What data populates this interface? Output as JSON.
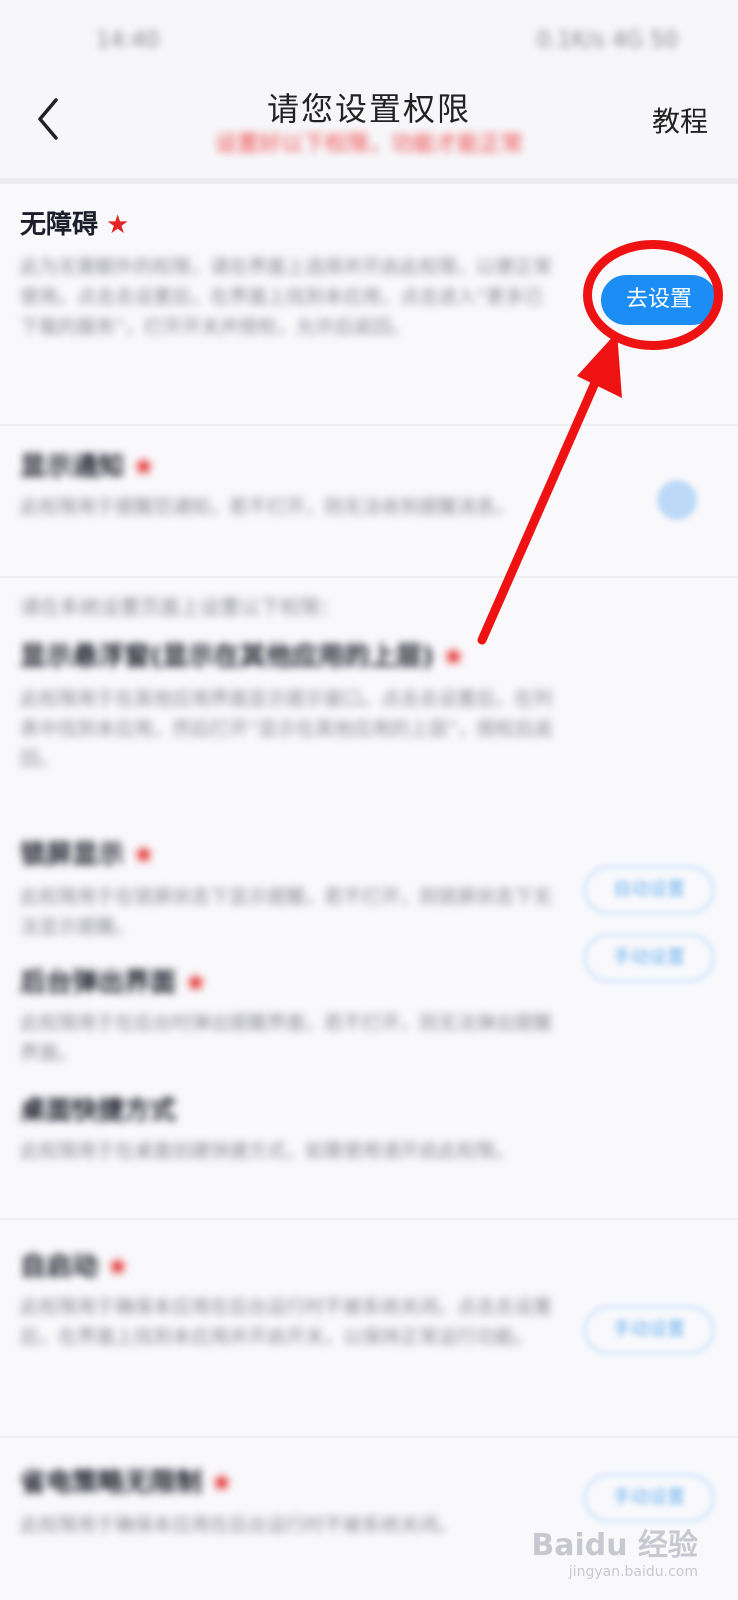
{
  "status_bar": {
    "time": "14:40",
    "icons": "0.1K/s 4G 50"
  },
  "header": {
    "title": "请您设置权限",
    "subtitle": "设置好以下权限，功能才能正常",
    "tutorial_label": "教程"
  },
  "sections": {
    "accessibility": {
      "title": "无障碍",
      "star": "★",
      "desc": "此为无需额外的权限，请在界面上选择并开启此权限，以便正常使用。点击去设置后，在界面上找到本应用，点击进入“更多已下载的服务”，打开开关并授权，允许后返回。",
      "button_label": "去设置"
    },
    "floating": {
      "title": "显示通知",
      "star": "★",
      "desc": "此权限用于提醒您通知，若不打开，则无法收到提醒消息。"
    },
    "extra_intro": "请在系统设置页面上设置以下权限：",
    "overlay": {
      "title": "显示悬浮窗(显示在其他应用的上层)",
      "star": "★",
      "desc": "此权限用于在其他应用界面显示提示窗口。点击去设置后，在列表中找到本应用，然后打开“显示在其他应用的上层”，授权后返回。"
    },
    "lockscreen": {
      "title": "锁屏显示",
      "star": "★",
      "desc": "此权限用于在锁屏状态下显示提醒，若不打开，则锁屏状态下无法显示提醒。",
      "button_label": "自动设置"
    },
    "background": {
      "title": "后台弹出界面",
      "star": "★",
      "desc": "此权限用于在后台时弹出提醒界面，若不打开，则无法弹出提醒界面。",
      "button_label": "手动设置"
    },
    "shortcut": {
      "title": "桌面快捷方式",
      "desc": "此权限用于在桌面创建快捷方式，如需使用请开启此权限。"
    },
    "autostart": {
      "title": "自启动",
      "star": "★",
      "desc": "此权限用于确保本应用在后台运行时不被系统关闭。点击去设置后，在界面上找到本应用并开启开关，以保持正常运行功能。",
      "button_label": "手动设置"
    },
    "battery": {
      "title": "省电策略无限制",
      "star": "★",
      "desc": "此权限用于确保本应用在后台运行时不被系统关闭。",
      "button_label": "手动设置"
    }
  },
  "watermark": {
    "brand": "Baidu 经验",
    "url": "jingyan.baidu.com"
  },
  "colors": {
    "accent": "#1b8df5",
    "star": "#e42525",
    "annotation": "#ee1212"
  }
}
